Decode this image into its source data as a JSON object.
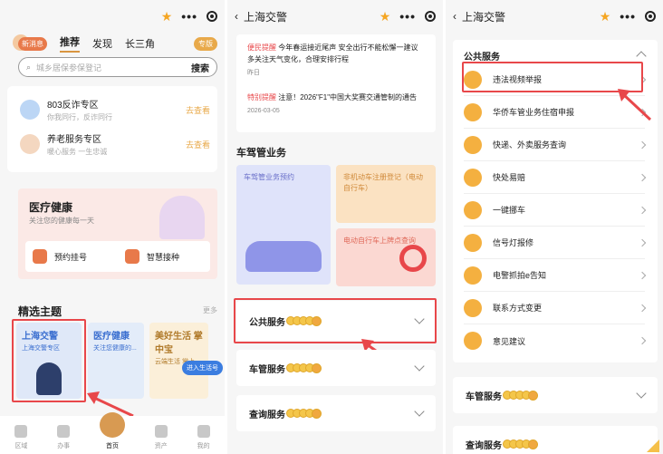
{
  "panel1": {
    "badge_new": "新消息",
    "nav": [
      "推荐",
      "发现",
      "长三角"
    ],
    "zhuanti": "专版",
    "search_placeholder": "城乡居保参保登记",
    "search_btn": "搜索",
    "services": [
      {
        "title": "803反诈专区",
        "sub": "你我同行，反诈同行",
        "go": "去查看"
      },
      {
        "title": "养老服务专区",
        "sub": "暖心服务 一生忠诚",
        "go": "去查看"
      }
    ],
    "health": {
      "title": "医疗健康",
      "sub": "关注您的健康每一天",
      "items": [
        "预约挂号",
        "智慧接种"
      ]
    },
    "theme_title": "精选主题",
    "theme_more": "更多",
    "themes": [
      {
        "title": "上海交警",
        "sub": "上海交警专区"
      },
      {
        "title": "医疗健康",
        "sub": "关注您健康的..."
      },
      {
        "title": "美好生活 掌中宝",
        "sub": "云端生活 掌上..."
      }
    ],
    "enter_label": "进入生活号",
    "tabs": [
      "区域",
      "办事",
      "首页",
      "资产",
      "我的"
    ]
  },
  "panel2": {
    "title": "上海交警",
    "news": [
      {
        "tag": "便民提醒",
        "text": "今年春运接近尾声 安全出行不能松懈一建议多关注天气变化，合理安排行程",
        "date": "昨日"
      },
      {
        "tag": "特别提醒",
        "text": "注意！2026\"F1\"中国大奖赛交通管制的通告",
        "date": "2026-03-05"
      }
    ],
    "section": "车驾管业务",
    "bigcard": "车驾管业务预约",
    "card_a": "非机动车注册登记（电动自行车）",
    "card_b": "电动自行车上牌点查询",
    "accordions": [
      "公共服务",
      "车管服务",
      "查询服务"
    ]
  },
  "panel3": {
    "title": "上海交警",
    "head": "公共服务",
    "items": [
      "违法视频举报",
      "华侨车管业务住宿申报",
      "快递、外卖服务查询",
      "快处易赔",
      "一键挪车",
      "信号灯报修",
      "电警抓拍e告知",
      "联系方式变更",
      "意见建议"
    ],
    "accordions": [
      "车管服务",
      "查询服务"
    ]
  },
  "colors": {
    "accent_red": "#e8474a",
    "gold": "#f5a623",
    "brand_orange": "#d99540"
  }
}
